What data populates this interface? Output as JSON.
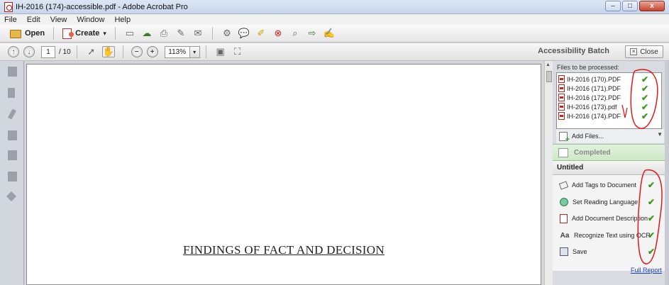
{
  "window": {
    "title": "IH-2016 (174)-accessible.pdf - Adobe Acrobat Pro",
    "controls": {
      "minimize": "–",
      "maximize": "□",
      "close": "x"
    }
  },
  "menu": [
    "File",
    "Edit",
    "View",
    "Window",
    "Help"
  ],
  "toolbar": {
    "open_label": "Open",
    "create_label": "Create",
    "create_dropdown": "▾"
  },
  "navigation": {
    "current_page": "1",
    "total_pages": "/ 10",
    "zoom": "113%",
    "zoom_dropdown": "▾"
  },
  "panel": {
    "title": "Accessibility Batch",
    "close_label": "Close",
    "files_label": "Files to be processed:",
    "files": [
      {
        "name": "IH-2016 (170).PDF",
        "status": "done"
      },
      {
        "name": "IH-2016 (171).PDF",
        "status": "done"
      },
      {
        "name": "IH-2016 (172).PDF",
        "status": "done"
      },
      {
        "name": "IH-2016 (173).pdf",
        "status": "done"
      },
      {
        "name": "IH-2016 (174).PDF",
        "status": "done"
      }
    ],
    "add_files_label": "Add Files...",
    "completed_label": "Completed",
    "action_group": "Untitled",
    "actions": [
      {
        "label": "Add Tags to Document",
        "icon": "tag-icon",
        "status": "done"
      },
      {
        "label": "Set Reading Language",
        "icon": "language-icon",
        "status": "done"
      },
      {
        "label": "Add Document Description",
        "icon": "description-icon",
        "status": "done"
      },
      {
        "label": "Recognize Text using OCR",
        "icon": "ocr-icon",
        "status": "done"
      },
      {
        "label": "Save",
        "icon": "save-icon",
        "status": "done"
      }
    ],
    "full_report_label": "Full Report"
  },
  "document": {
    "heading": "FINDINGS OF FACT AND DECISION"
  },
  "colors": {
    "check": "#3a9a1c",
    "annotation": "#e01818",
    "link": "#1a3ec7"
  }
}
